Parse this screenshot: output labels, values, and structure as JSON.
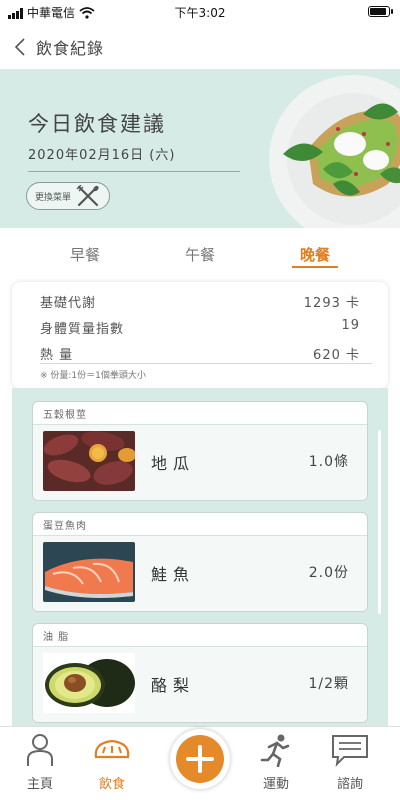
{
  "status_bar": {
    "carrier": "中華電信",
    "time": "下午3:02"
  },
  "nav": {
    "back_title": "飲食紀錄"
  },
  "hero": {
    "title": "今日飲食建議",
    "date": "2020年02月16日 (六)",
    "swap_label": "更換菜單"
  },
  "tabs": [
    {
      "label": "早餐",
      "active": false
    },
    {
      "label": "午餐",
      "active": false
    },
    {
      "label": "晚餐",
      "active": true
    }
  ],
  "summary": {
    "rows": [
      {
        "label": "基礎代謝",
        "value": "1293 卡"
      },
      {
        "label": "身體質量指數",
        "value": "19"
      },
      {
        "label": "熱 量",
        "value": "620 卡"
      }
    ],
    "note": "※ 份量:1份＝1個拳頭大小"
  },
  "foods": [
    {
      "category": "五穀根莖",
      "name": "地瓜",
      "amount": "1.0條",
      "icon": "sweet-potato-image"
    },
    {
      "category": "蛋豆魚肉",
      "name": "鮭魚",
      "amount": "2.0份",
      "icon": "salmon-image"
    },
    {
      "category": "油 脂",
      "name": "酪梨",
      "amount": "1/2顆",
      "icon": "avocado-image"
    }
  ],
  "bottom_nav": [
    {
      "label": "主頁",
      "icon": "person-icon",
      "active": false
    },
    {
      "label": "飲食",
      "icon": "bread-icon",
      "active": true
    },
    {
      "label": "運動",
      "icon": "running-icon",
      "active": false
    },
    {
      "label": "諮詢",
      "icon": "chat-icon",
      "active": false
    }
  ],
  "colors": {
    "accent": "#e07f21",
    "mint": "#d6ebe5"
  }
}
